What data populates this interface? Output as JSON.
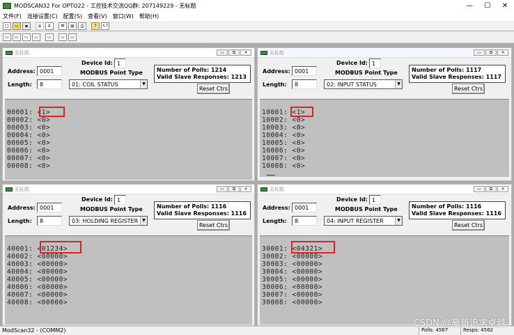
{
  "app": {
    "title": "MODSCAN32 For OPTO22 - 工控技术交流QQ群: 207149229 - 无标题",
    "minimize": "—",
    "maximize": "☐",
    "close": "✕"
  },
  "menu": [
    "文件(F)",
    "连接设置(C)",
    "配置(S)",
    "查看(V)",
    "窗口(W)",
    "帮助(H)"
  ],
  "toolbar": {
    "row1_icons": [
      "new-icon",
      "open-icon",
      "save-icon",
      "record-icon",
      "euro-icon",
      "tool-icon",
      "print-preview-icon",
      "print-icon",
      "help-icon",
      "context-help-icon"
    ],
    "row2_icons": [
      "display-binary-icon",
      "display-decimal-icon",
      "display-hex-icon",
      "display-float-icon",
      "display-dbl-icon",
      "display-swap-icon",
      "display-comm-icon"
    ]
  },
  "windows": [
    {
      "title": "无标题",
      "device_id_label": "Device Id:",
      "device_id": "1",
      "point_type_label": "MODBUS Point Type",
      "address_label": "Address:",
      "address": "0001",
      "length_label": "Length:",
      "length": "8",
      "point_type": "01: COIL STATUS",
      "polls_line": "Number of Polls: 1214",
      "responses_line": "Valid Slave Responses: 1213",
      "reset_label": "Reset Ctrs",
      "rows": [
        "00001: <1>",
        "00002: <0>",
        "00003: <0>",
        "00004: <0>",
        "00005: <0>",
        "00006: <0>",
        "00007: <0>",
        "00008: <0>"
      ]
    },
    {
      "title": "无标题",
      "device_id_label": "Device Id:",
      "device_id": "1",
      "point_type_label": "MODBUS Point Type",
      "address_label": "Address:",
      "address": "0001",
      "length_label": "Length:",
      "length": "8",
      "point_type": "02: INPUT STATUS",
      "polls_line": "Number of Polls: 1117",
      "responses_line": "Valid Slave Responses: 1117",
      "reset_label": "Reset Ctrs",
      "rows": [
        "10001: <1>",
        "10002: <0>",
        "10003: <0>",
        "10004: <0>",
        "10005: <0>",
        "10006: <0>",
        "10007: <0>",
        "10008: <0>"
      ]
    },
    {
      "title": "无标题",
      "device_id_label": "Device Id:",
      "device_id": "1",
      "point_type_label": "MODBUS Point Type",
      "address_label": "Address:",
      "address": "0001",
      "length_label": "Length:",
      "length": "8",
      "point_type": "03: HOLDING REGISTER",
      "polls_line": "Number of Polls: 1116",
      "responses_line": "Valid Slave Responses: 1116",
      "reset_label": "Reset Ctrs",
      "rows": [
        "40001: <01234>",
        "40002: <00000>",
        "40003: <00000>",
        "40004: <00000>",
        "40005: <00000>",
        "40006: <00000>",
        "40007: <00000>",
        "40008: <00000>"
      ]
    },
    {
      "title": "无标题",
      "device_id_label": "Device Id:",
      "device_id": "1",
      "point_type_label": "MODBUS Point Type",
      "address_label": "Address:",
      "address": "0001",
      "length_label": "Length:",
      "length": "8",
      "point_type": "04: INPUT REGISTER",
      "polls_line": "Number of Polls: 1116",
      "responses_line": "Valid Slave Responses: 1116",
      "reset_label": "Reset Ctrs",
      "rows": [
        "30001: <04321>",
        "30002: <00000>",
        "30003: <00000>",
        "30004: <00000>",
        "30005: <00000>",
        "30006: <00000>",
        "30007: <00000>",
        "30008: <00000>"
      ]
    }
  ],
  "status": {
    "left": "ModScan32 - (COMM2)",
    "polls": "Polls: 4567",
    "resps": "Resps: 4562"
  },
  "watermark": "CSDN @豪哥追求卓越"
}
